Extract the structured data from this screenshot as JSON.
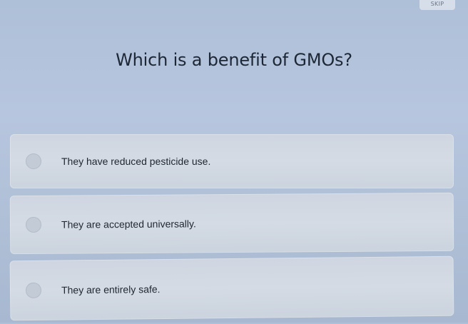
{
  "header": {
    "skip_label": "SKIP"
  },
  "question": {
    "text": "Which is a benefit of GMOs?"
  },
  "options": [
    {
      "label": "They have reduced pesticide use."
    },
    {
      "label": "They are accepted universally."
    },
    {
      "label": "They are entirely safe."
    }
  ]
}
